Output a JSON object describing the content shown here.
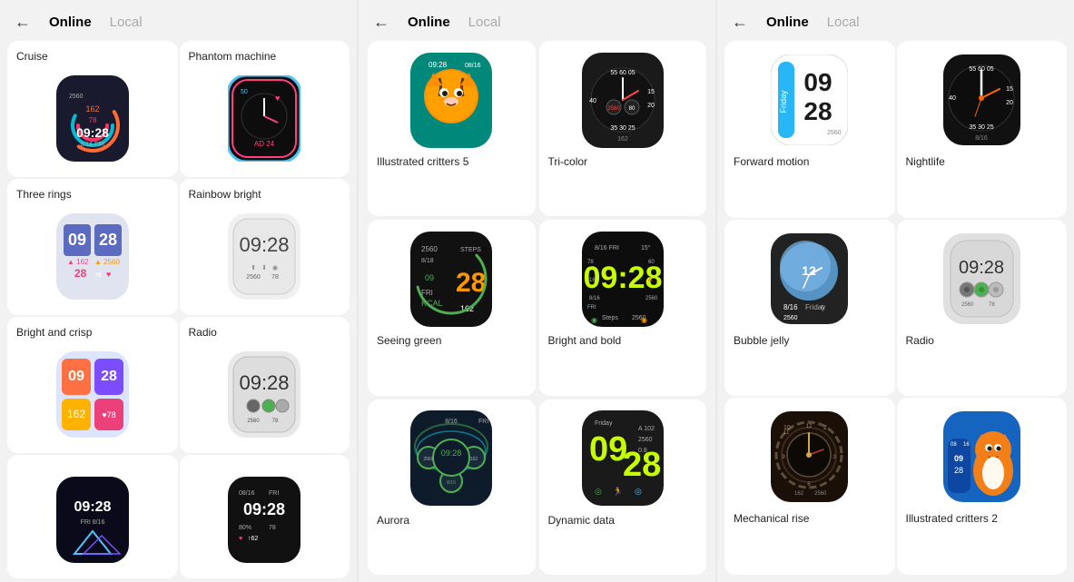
{
  "panels": [
    {
      "id": "left",
      "header": {
        "back": "←",
        "online": "Online",
        "local": "Local"
      },
      "cards": [
        {
          "label": "Cruise",
          "position": "top-left"
        },
        {
          "label": "Phantom machine",
          "position": "top-right"
        },
        {
          "label": "Three rings",
          "position": "mid-left"
        },
        {
          "label": "Rainbow bright",
          "position": "mid-right"
        },
        {
          "label": "Bright and crisp",
          "position": "bot-left"
        },
        {
          "label": "Radio",
          "position": "bot-right"
        },
        {
          "label": "",
          "position": "btm-left"
        },
        {
          "label": "",
          "position": "btm-right"
        }
      ]
    },
    {
      "id": "middle",
      "header": {
        "back": "←",
        "online": "Online",
        "local": "Local"
      },
      "cards": [
        {
          "label": "Illustrated critters 5",
          "position": "top-left"
        },
        {
          "label": "Tri-color",
          "position": "top-right"
        },
        {
          "label": "Seeing green",
          "position": "mid-left"
        },
        {
          "label": "Bright and bold",
          "position": "mid-right"
        },
        {
          "label": "Aurora",
          "position": "bot-left"
        },
        {
          "label": "Dynamic data",
          "position": "bot-right"
        }
      ]
    },
    {
      "id": "right",
      "header": {
        "back": "←",
        "online": "Online",
        "local": "Local"
      },
      "cards": [
        {
          "label": "Forward motion",
          "position": "top-left"
        },
        {
          "label": "Nightlife",
          "position": "top-right"
        },
        {
          "label": "Bubble jelly",
          "position": "mid-left"
        },
        {
          "label": "Radio",
          "position": "mid-right"
        },
        {
          "label": "Mechanical rise",
          "position": "bot-left"
        },
        {
          "label": "Illustrated critters 2",
          "position": "bot-right"
        }
      ]
    }
  ]
}
